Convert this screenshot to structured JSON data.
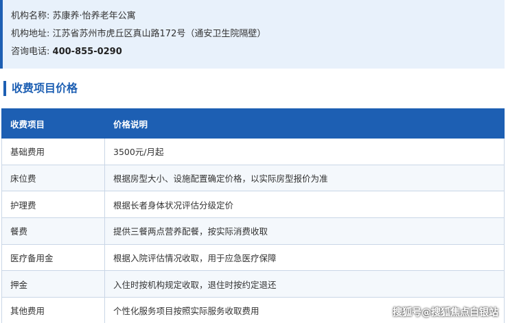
{
  "info": {
    "name_label": "机构名称:",
    "name_value": "苏康养·怡养老年公寓",
    "address_label": "机构地址:",
    "address_value": "江苏省苏州市虎丘区真山路172号（通安卫生院隔壁）",
    "phone_label": "咨询电话:",
    "phone_value": "400-855-0290"
  },
  "section_title": "收费项目价格",
  "table": {
    "headers": [
      "收费项目",
      "价格说明"
    ],
    "rows": [
      [
        "基础费用",
        "3500元/月起"
      ],
      [
        "床位费",
        "根据房型大小、设施配置确定价格，以实际房型报价为准"
      ],
      [
        "护理费",
        "根据长者身体状况评估分级定价"
      ],
      [
        "餐费",
        "提供三餐两点营养配餐，按实际消费收取"
      ],
      [
        "医疗备用金",
        "根据入院评估情况收取，用于应急医疗保障"
      ],
      [
        "押金",
        "入住时按机构规定收取，退住时按约定退还"
      ],
      [
        "其他费用",
        "个性化服务项目按照实际服务收取费用"
      ]
    ]
  },
  "watermark": "搜狐号@搜狐焦点白银站",
  "colors": {
    "accent": "#1d5fb3",
    "info_bg": "#e8f1fb",
    "row_alt": "#f4f8fc"
  }
}
